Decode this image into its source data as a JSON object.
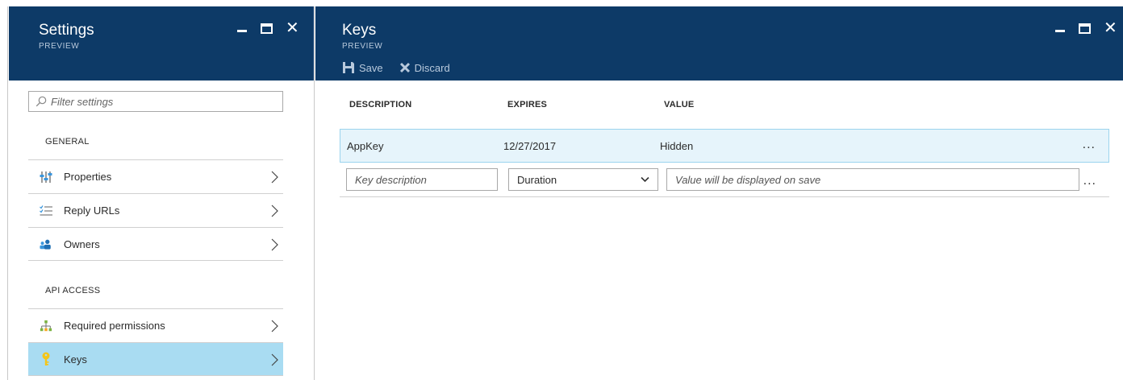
{
  "settings_blade": {
    "title": "Settings",
    "subtitle": "PREVIEW",
    "filter_placeholder": "Filter settings",
    "sections": {
      "general": "GENERAL",
      "api_access": "API ACCESS"
    },
    "general_items": [
      {
        "label": "Properties",
        "icon": "properties-icon"
      },
      {
        "label": "Reply URLs",
        "icon": "list-icon"
      },
      {
        "label": "Owners",
        "icon": "owners-icon"
      }
    ],
    "api_items": [
      {
        "label": "Required permissions",
        "icon": "permissions-icon"
      },
      {
        "label": "Keys",
        "icon": "key-icon",
        "active": true
      }
    ]
  },
  "keys_blade": {
    "title": "Keys",
    "subtitle": "PREVIEW",
    "commands": {
      "save": "Save",
      "discard": "Discard"
    },
    "columns": {
      "description": "DESCRIPTION",
      "expires": "EXPIRES",
      "value": "VALUE"
    },
    "rows": [
      {
        "description": "AppKey",
        "expires": "12/27/2017",
        "value": "Hidden",
        "more": "..."
      }
    ],
    "new_row": {
      "description_placeholder": "Key description",
      "duration_selected": "Duration",
      "value_placeholder": "Value will be displayed on save",
      "more": "..."
    }
  },
  "colors": {
    "header_bg": "#0d3a67",
    "active_item_bg": "#a9dcf2",
    "selected_row_bg": "#e6f4fb"
  }
}
